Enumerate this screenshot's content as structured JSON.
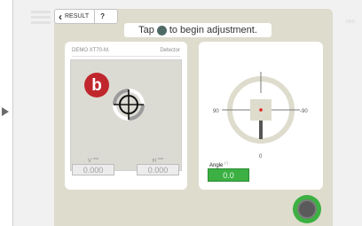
{
  "header": {
    "back_button": {
      "label": "RESULT",
      "icon": "chevron-left-icon"
    },
    "help_label": "?",
    "banner": {
      "before": "Tap",
      "after": "to begin adjustment.",
      "dot_color": "#4e6a65"
    },
    "faded_text": "mm"
  },
  "detector": {
    "model": "DEMO XT70-M.",
    "title": "Detector",
    "badge": "b",
    "vertical": {
      "label": "V",
      "unit": "mm",
      "value": "0.000"
    },
    "horizontal": {
      "label": "H",
      "unit": "mm",
      "value": "0.000"
    }
  },
  "angle_gauge": {
    "left_label": "90",
    "right_label": "-90",
    "bottom_label": "0",
    "angle_label": "Angle",
    "angle_unit": "(°)",
    "angle_value": "0.0"
  },
  "colors": {
    "panel_bg": "#dedccd",
    "accent_green": "#3cb043",
    "badge_red": "#c0272d"
  }
}
